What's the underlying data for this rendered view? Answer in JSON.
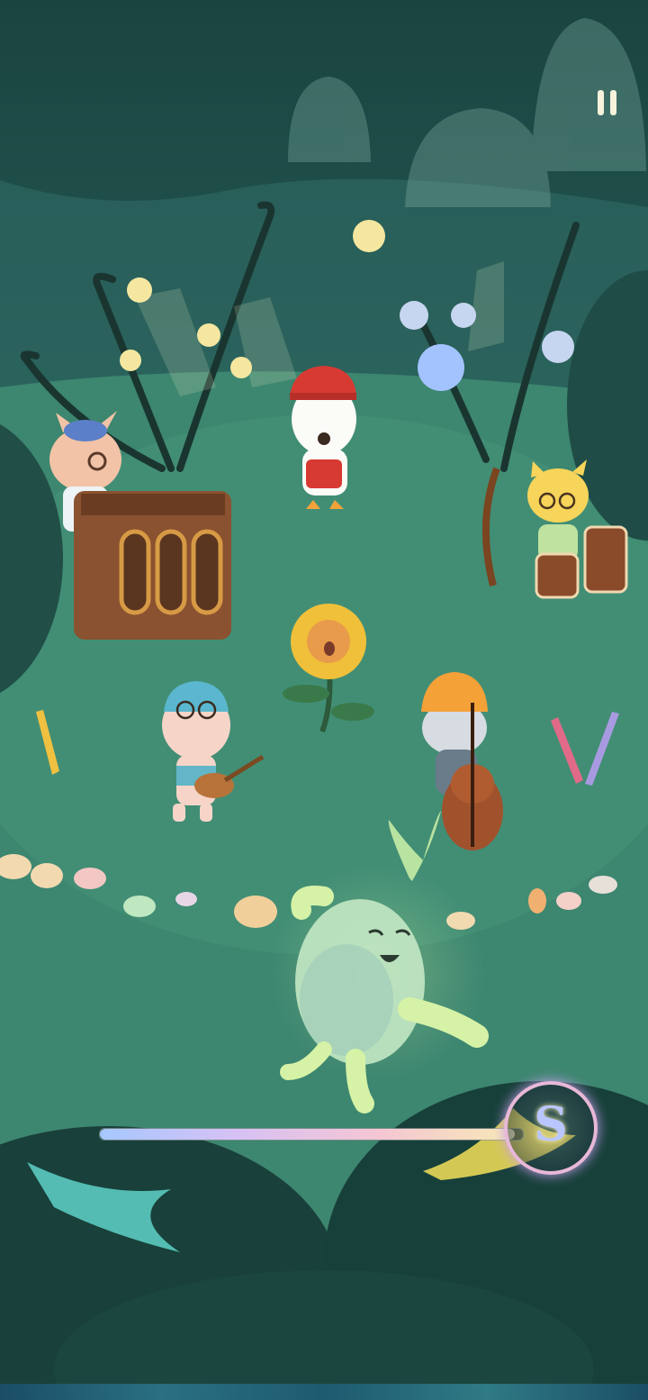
{
  "game": {
    "pause_icon": "pause-icon",
    "skill_icon": "swirl-s-icon",
    "song_progress": 0.98,
    "characters": [
      "pig-pianist",
      "duck-singer",
      "cat-drummer",
      "sunflower-singer",
      "bear-ukulele",
      "raccoon-cellist",
      "sprout-spirit-dancer"
    ],
    "colors": {
      "grass": "#3f8b72",
      "sky": "#1d4a44",
      "accent": "#f3d04a"
    }
  }
}
